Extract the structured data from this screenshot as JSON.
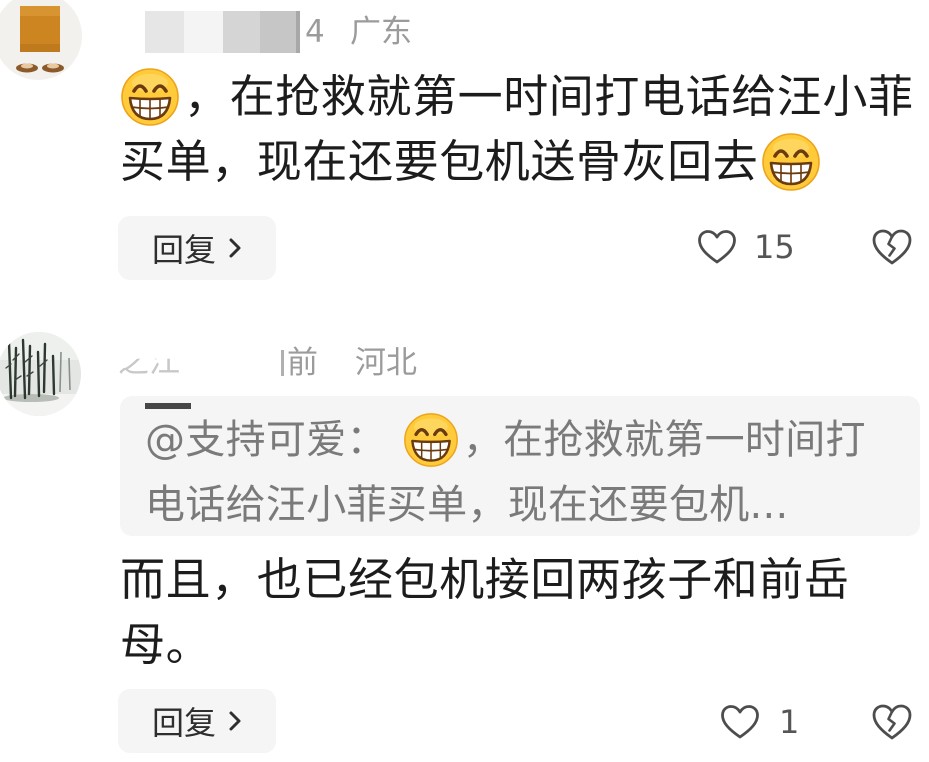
{
  "colors": {
    "background": "#ffffff",
    "text_primary": "#1c1c1c",
    "text_meta": "#9b9b9b",
    "text_quote": "#7a7a7a",
    "panel_bg": "#f5f5f5",
    "emoji_yellow": "#ffcb3b"
  },
  "comments": [
    {
      "avatar_icon": "avatar-image",
      "time_partial": "4",
      "location": "广东",
      "emoji_icon": "grinning-face-with-smiling-eyes",
      "text_lines": [
        "，在抢救就第一时间打电话给汪小菲",
        "买单，现在还要包机送骨灰回去"
      ],
      "reply_label": "回复",
      "reply_icon": "chevron-right-icon",
      "like_icon": "heart-outline-icon",
      "like_count": "15",
      "dislike_icon": "broken-heart-icon"
    },
    {
      "avatar_icon": "avatar-image",
      "username_partial": "之江",
      "time_partial": "前",
      "location": "河北",
      "quote": {
        "mention": "@支持可爱：",
        "line_1_after_emoji": "，在抢救就第一时间打",
        "line_2": "电话给汪小菲买单，现在还要包机..."
      },
      "text_lines": [
        "而且，也已经包机接回两孩子和前岳",
        "母。"
      ],
      "reply_label": "回复",
      "like_count": "1"
    }
  ]
}
